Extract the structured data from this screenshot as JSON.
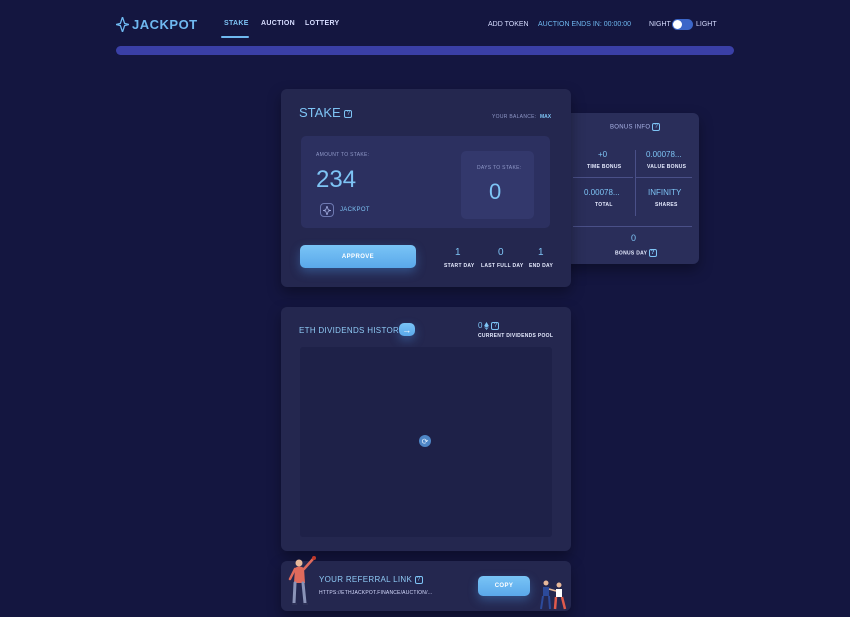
{
  "header": {
    "logo_text": "JACKPOT",
    "tabs": [
      {
        "label": "STAKE",
        "active": true
      },
      {
        "label": "AUCTION",
        "active": false
      },
      {
        "label": "LOTTERY",
        "active": false
      }
    ],
    "add_token": "ADD TOKEN",
    "auction_ends_label": "AUCTION ENDS IN: 00:00:00",
    "night_label": "NIGHT",
    "light_label": "LIGHT"
  },
  "stake": {
    "title": "STAKE",
    "help": "?",
    "balance_label": "YOUR BALANCE:",
    "max_label": "MAX",
    "amount_label": "AMOUNT TO STAKE:",
    "amount_value": "234",
    "token_name": "JACKPOT",
    "days_label": "DAYS TO STAKE:",
    "days_value": "0",
    "approve_label": "APPROVE",
    "start_day_value": "1",
    "start_day_label": "START DAY",
    "last_full_day_value": "0",
    "last_full_day_label": "LAST FULL DAY",
    "end_day_value": "1",
    "end_day_label": "END DAY"
  },
  "bonus": {
    "title": "BONUS INFO",
    "help": "?",
    "time_bonus_value": "+0",
    "time_bonus_label": "TIME BONUS",
    "value_bonus_value": "0.00078...",
    "value_bonus_label": "VALUE BONUS",
    "total_value": "0.00078...",
    "total_label": "TOTAL",
    "shares_value": "INFINITY",
    "shares_label": "SHARES",
    "bonus_day_value": "0",
    "bonus_day_label": "BONUS DAY"
  },
  "dividends": {
    "title": "ETH DIVIDENDS HISTORY",
    "arrow": "→",
    "pool_value": "0",
    "pool_label": "CURRENT DIVIDENDS POOL",
    "help": "?"
  },
  "referral": {
    "title": "YOUR REFERRAL LINK",
    "help": "?",
    "link": "HTTPS://ETHJACKPOT.FINANCE/AUCTION/...",
    "copy_label": "COPY"
  },
  "colors": {
    "background": "#141640",
    "accent": "#6fb8f0",
    "card": "#24274f"
  },
  "icons": [
    "jackpot-logo-icon",
    "help-icon",
    "eth-icon",
    "arrow-right-icon",
    "loading-icon"
  ]
}
